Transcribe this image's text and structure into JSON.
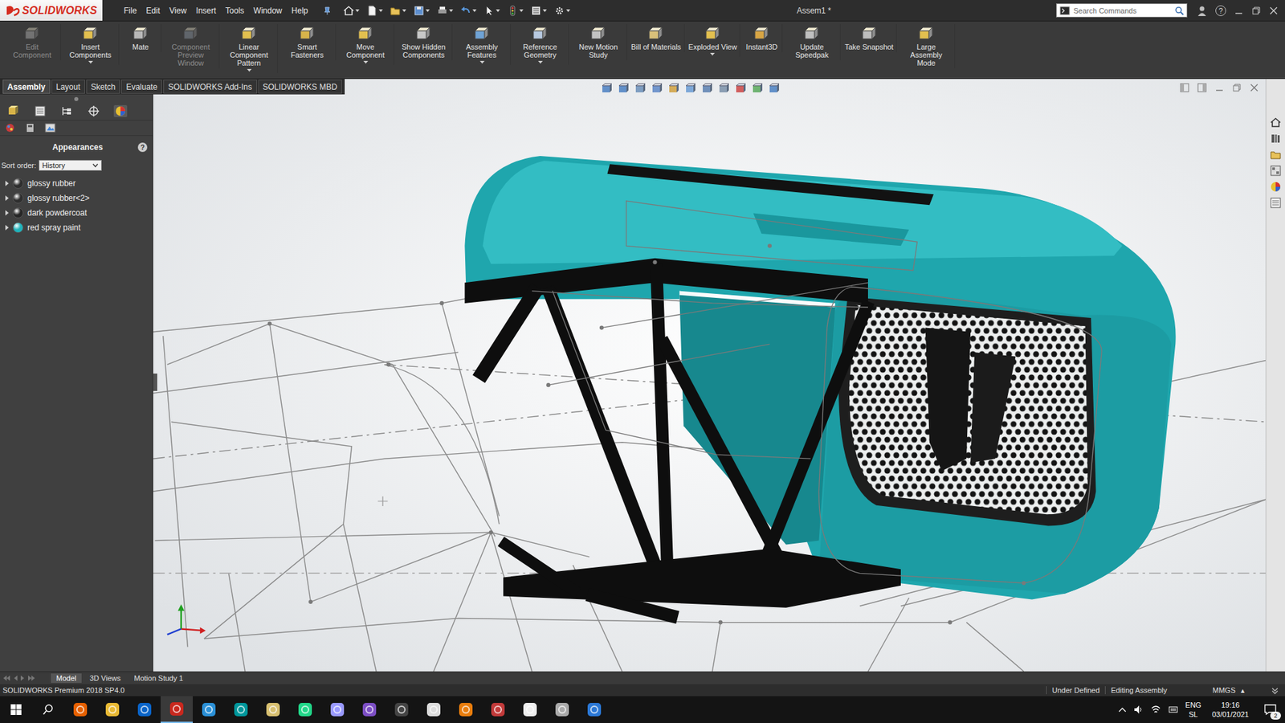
{
  "app": {
    "logo": "SOLIDWORKS"
  },
  "window": {
    "title": "Assem1 *"
  },
  "menu": [
    "File",
    "Edit",
    "View",
    "Insert",
    "Tools",
    "Window",
    "Help"
  ],
  "search": {
    "placeholder": "Search Commands"
  },
  "help_button": "?",
  "ribbon": [
    {
      "label": "Edit Component",
      "disabled": true,
      "has_menu": false
    },
    {
      "label": "Insert Components",
      "disabled": false,
      "has_menu": true
    },
    {
      "label": "Mate",
      "disabled": false,
      "has_menu": false
    },
    {
      "label": "Component Preview Window",
      "disabled": true,
      "has_menu": false
    },
    {
      "label": "Linear Component Pattern",
      "disabled": false,
      "has_menu": true
    },
    {
      "label": "Smart Fasteners",
      "disabled": false,
      "has_menu": false
    },
    {
      "label": "Move Component",
      "disabled": false,
      "has_menu": true
    },
    {
      "label": "Show Hidden Components",
      "disabled": false,
      "has_menu": false
    },
    {
      "label": "Assembly Features",
      "disabled": false,
      "has_menu": true
    },
    {
      "label": "Reference Geometry",
      "disabled": false,
      "has_menu": true
    },
    {
      "label": "New Motion Study",
      "disabled": false,
      "has_menu": false
    },
    {
      "label": "Bill of Materials",
      "disabled": false,
      "has_menu": false
    },
    {
      "label": "Exploded View",
      "disabled": false,
      "has_menu": true
    },
    {
      "label": "Instant3D",
      "disabled": false,
      "has_menu": false
    },
    {
      "label": "Update Speedpak",
      "disabled": false,
      "has_menu": false
    },
    {
      "label": "Take Snapshot",
      "disabled": false,
      "has_menu": false
    },
    {
      "label": "Large Assembly Mode",
      "disabled": false,
      "has_menu": false
    }
  ],
  "tabs": [
    {
      "label": "Assembly",
      "selected": true
    },
    {
      "label": "Layout",
      "selected": false
    },
    {
      "label": "Sketch",
      "selected": false
    },
    {
      "label": "Evaluate",
      "selected": false
    },
    {
      "label": "SOLIDWORKS Add-Ins",
      "selected": false
    },
    {
      "label": "SOLIDWORKS MBD",
      "selected": false
    }
  ],
  "left_panel": {
    "title": "Appearances",
    "help": "?",
    "sort_label": "Sort order:",
    "sort_value": "History",
    "items": [
      {
        "name": "glossy rubber",
        "color": "#2e2e2e",
        "expanded": false
      },
      {
        "name": "glossy rubber<2>",
        "color": "#2e2e2e",
        "expanded": false
      },
      {
        "name": "dark powdercoat",
        "color": "#262626",
        "expanded": false
      },
      {
        "name": "red spray paint",
        "color": "#1fb3bb",
        "expanded": false
      }
    ]
  },
  "model_tabs": [
    {
      "label": "Model",
      "selected": true
    },
    {
      "label": "3D Views",
      "selected": false
    },
    {
      "label": "Motion Study 1",
      "selected": false
    }
  ],
  "status_bar": {
    "product": "SOLIDWORKS Premium 2018 SP4.0",
    "items": [
      "Under Defined",
      "Editing Assembly"
    ],
    "units": "MMGS",
    "units_arrow": "▴"
  },
  "taskbar": {
    "apps": [
      {
        "kind": "firefox",
        "active": false
      },
      {
        "kind": "explorer",
        "active": false
      },
      {
        "kind": "outlook",
        "active": false
      },
      {
        "kind": "solidworks",
        "active": true
      },
      {
        "kind": "ccleaner",
        "active": false
      },
      {
        "kind": "arduino",
        "active": false
      },
      {
        "kind": "archive",
        "active": false
      },
      {
        "kind": "pycharm",
        "active": false
      },
      {
        "kind": "premiere",
        "active": false
      },
      {
        "kind": "visualstudio",
        "active": false
      },
      {
        "kind": "unity",
        "active": false
      },
      {
        "kind": "studio",
        "active": false
      },
      {
        "kind": "blender",
        "active": false
      },
      {
        "kind": "davinci",
        "active": false
      },
      {
        "kind": "inkscape",
        "active": false
      },
      {
        "kind": "pen",
        "active": false
      },
      {
        "kind": "notes",
        "active": false
      }
    ],
    "language": "ENG",
    "layout": "SL",
    "time": "19:16",
    "date": "03/01/2021",
    "notifications": "2"
  }
}
